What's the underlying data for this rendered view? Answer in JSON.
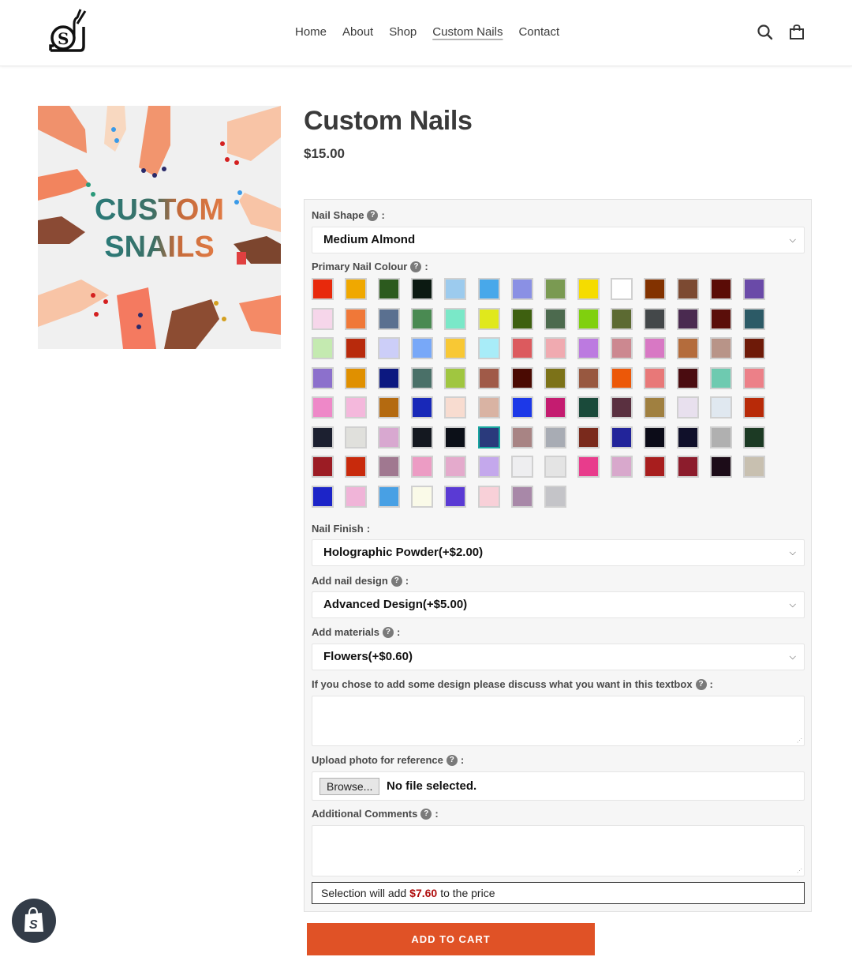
{
  "header": {
    "logo_alt": "Snail logo",
    "nav": [
      {
        "label": "Home",
        "active": false
      },
      {
        "label": "About",
        "active": false
      },
      {
        "label": "Shop",
        "active": false
      },
      {
        "label": "Custom Nails",
        "active": true
      },
      {
        "label": "Contact",
        "active": false
      }
    ],
    "icons": {
      "search": "search-icon",
      "cart": "cart-icon"
    }
  },
  "product": {
    "image_text_line1": "CUSTOM",
    "image_text_line2": "SNAILS",
    "title": "Custom Nails",
    "price": "$15.00"
  },
  "options": {
    "nail_shape": {
      "label": "Nail Shape",
      "suffix": ":",
      "value": "Medium Almond"
    },
    "primary_colour": {
      "label": "Primary Nail Colour",
      "suffix": ":",
      "selected_index": 75,
      "swatches": [
        "#e8290c",
        "#f0a800",
        "#2c5a1e",
        "#0c1a12",
        "#9ccbee",
        "#48a8ea",
        "#8a90e4",
        "#7a9a52",
        "#f5dc00",
        "#ffffff",
        "#823200",
        "#7c4a32",
        "#5a0c06",
        "#6a4aa8",
        "#f6d6ea",
        "#f07838",
        "#5a7090",
        "#4a8a52",
        "#7ae8c8",
        "#e0e81c",
        "#3e6010",
        "#4c6a4e",
        "#80d00e",
        "#5c6a32",
        "#44484a",
        "#4a2a50",
        "#5a0e0a",
        "#2c5a66",
        "#c4eab0",
        "#b82a0c",
        "#cccef8",
        "#78a8f8",
        "#f8c834",
        "#a8ecf8",
        "#dc5a5e",
        "#f0aab0",
        "#bc7ae0",
        "#cc8890",
        "#d878c4",
        "#b46c3c",
        "#b89488",
        "#6e1a08",
        "#8c70cc",
        "#e09000",
        "#0c1880",
        "#4a7068",
        "#a0c640",
        "#a05a48",
        "#4a0a02",
        "#7c7218",
        "#985840",
        "#ec5808",
        "#e87878",
        "#4a0c10",
        "#6ecab0",
        "#ec8088",
        "#ee88c8",
        "#f4b8dc",
        "#b46a10",
        "#1828b8",
        "#f8dcd0",
        "#d9b3a3",
        "#1c38e8",
        "#c41c70",
        "#1a4a3a",
        "#5a3040",
        "#a08040",
        "#e8e0ee",
        "#e0e8f0",
        "#b82a08",
        "#1c2030",
        "#e0e0dc",
        "#d8a8d0",
        "#141820",
        "#0c1018",
        "#2a3a7c",
        "#a88484",
        "#a8acb4",
        "#7a2a1c",
        "#22249a",
        "#0c0c18",
        "#10102a",
        "#b0b0b0",
        "#1c3a24",
        "#9c1c24",
        "#c82a0c",
        "#a07890",
        "#ec9cc4",
        "#e4aacc",
        "#c4a8ec",
        "#eeeef0",
        "#e4e4e4",
        "#e83c8c",
        "#d8a8cc",
        "#a81e1e",
        "#8c1c2c",
        "#1c0c18",
        "#c8c0b0",
        "#1c24c8",
        "#f0b4d8",
        "#48a0e4",
        "#fafae8",
        "#5a3ad4",
        "#f8d0d8",
        "#a888a8",
        "#c4c4c8"
      ]
    },
    "nail_finish": {
      "label": "Nail Finish",
      "suffix": ":",
      "value": "Holographic Powder(+$2.00)"
    },
    "nail_design": {
      "label": "Add nail design",
      "suffix": ":",
      "value": "Advanced Design(+$5.00)"
    },
    "materials": {
      "label": "Add materials",
      "suffix": ":",
      "value": "Flowers(+$0.60)"
    },
    "design_notes": {
      "label": "If you chose to add some design please discuss what you want in this textbox",
      "suffix": ":",
      "value": "",
      "placeholder": ""
    },
    "upload": {
      "label": "Upload photo for reference",
      "suffix": ":",
      "button": "Browse...",
      "status": "No file selected."
    },
    "comments": {
      "label": "Additional Comments",
      "suffix": ":",
      "value": "",
      "placeholder": ""
    },
    "summary": {
      "prefix": "Selection will add",
      "amount": "$7.60",
      "suffix": "to the price"
    }
  },
  "add_to_cart": {
    "label": "ADD TO CART"
  },
  "shopify_badge": {
    "icon": "shopify-bag-icon"
  }
}
